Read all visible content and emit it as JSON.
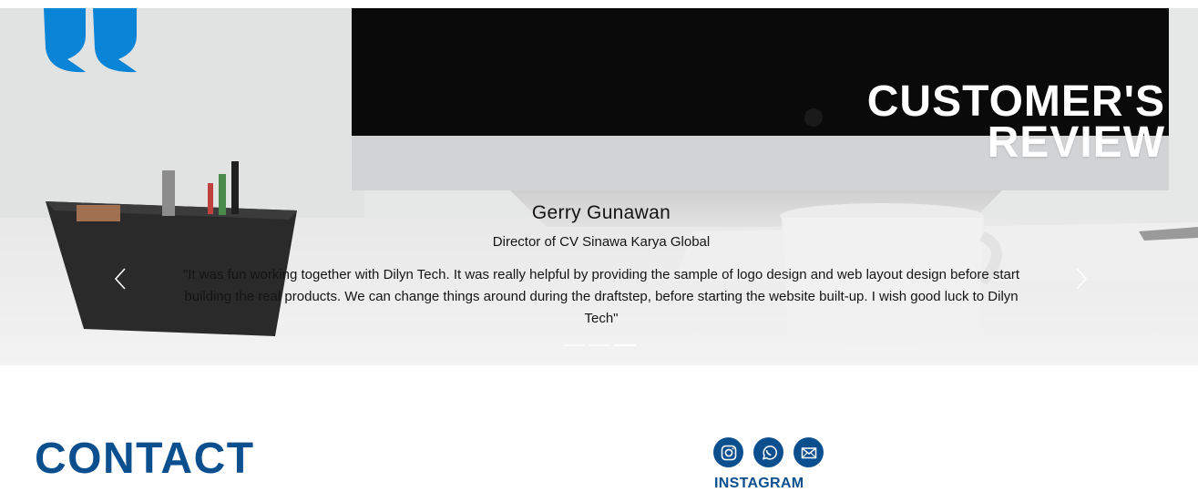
{
  "hero": {
    "title_line1": "CUSTOMER'S",
    "title_line2": "REVIEW"
  },
  "review": {
    "name": "Gerry Gunawan",
    "role": "Director of CV Sinawa Karya Global",
    "text": "\"It was fun working together with Dilyn Tech. It was really helpful by providing the sample of logo design and web layout design before start building the real products. We can change things around during the draftstep, before starting the website built-up. I wish good luck to Dilyn Tech\""
  },
  "carousel": {
    "prev_icon": "chevron-left-icon",
    "next_icon": "chevron-right-icon",
    "slide_count": 3,
    "active_index": 2
  },
  "contact": {
    "heading": "CONTACT",
    "social_label": "INSTAGRAM",
    "social_icons": [
      "instagram-icon",
      "whatsapp-icon",
      "mail-icon"
    ]
  },
  "colors": {
    "brand_blue": "#0c4f8f",
    "quote_blue": "#0a84d6",
    "hero_text": "#ffffff"
  }
}
